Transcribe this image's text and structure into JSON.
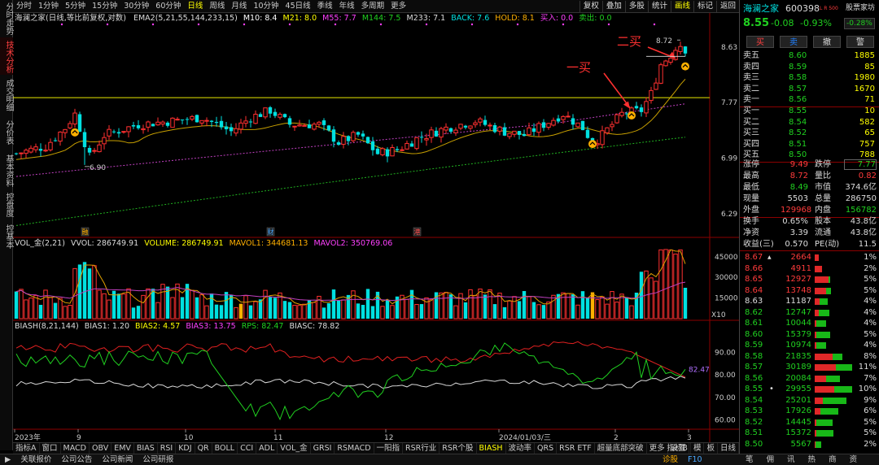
{
  "left_tabs": [
    "分时走势",
    "技术分析",
    "成交明细",
    "分价表",
    "基本资料",
    "控盘度",
    "控基本"
  ],
  "left_active": 1,
  "timeframes": [
    "分时",
    "1分钟",
    "5分钟",
    "15分钟",
    "30分钟",
    "60分钟",
    "日线",
    "周线",
    "月线",
    "10分钟",
    "45日线",
    "季线",
    "年线",
    "多周期",
    "更多"
  ],
  "timeframe_active": "日线",
  "toolbar": [
    "复权",
    "叠加",
    "多股",
    "统计",
    "画线",
    "标记",
    "返回"
  ],
  "toolbar_active": "画线",
  "chart_title": "海澜之家(日线,等比前复权,对数)",
  "ema_line": {
    "label": "EMA2(5,21,55,144,233,15)",
    "m10": "M10: 8.4",
    "m21": "M21: 8.0",
    "m55": "M55: 7.7",
    "m144": "M144: 7.5",
    "m233": "M233: 7.1",
    "back": "BACK: 7.6",
    "hold": "HOLD: 8.1",
    "buy": "买入: 0.0",
    "sell": "卖出: 0.0"
  },
  "price_axis": [
    "8.63",
    "7.77",
    "6.99",
    "6.29"
  ],
  "annotations": {
    "first_buy": "一买",
    "second_buy": "二买",
    "high_label": "8.72",
    "low_label": "6.90"
  },
  "event_marks": [
    "融",
    "财",
    "港"
  ],
  "vol_line": {
    "label": "VOL_金(2,21)",
    "vvol": "VVOL: 286749.91",
    "volume": "VOLUME: 286749.91",
    "mavol1": "MAVOL1: 344681.13",
    "mavol2": "MAVOL2: 350769.06"
  },
  "vol_axis": [
    "45000",
    "30000",
    "15000"
  ],
  "vol_unit": "X10",
  "bias_line": {
    "label": "BIASH(8,21,144)",
    "bias1": "BIAS1: 1.20",
    "bias2": "BIAS2: 4.57",
    "bias3": "BIAS3: 13.75",
    "rps": "RPS: 82.47",
    "biasc": "BIASC: 78.82"
  },
  "bias_axis": [
    "90.00",
    "80.00",
    "70.00",
    "60.00"
  ],
  "rps_value": "82.47",
  "date_axis": [
    "2023年",
    "9",
    "10",
    "11",
    "12",
    "2024/01/03/三",
    "2",
    "3"
  ],
  "bottom_tabs": [
    "指标A",
    "窗口",
    "MACD",
    "OBV",
    "EMV",
    "BIAS",
    "RSI",
    "KDJ",
    "QR",
    "BOLL",
    "CCI",
    "ADL",
    "VOL_金",
    "GRSI",
    "RSMACD",
    "一阳指",
    "RSR行业",
    "RSR个股",
    "BIASH",
    "波动率",
    "QRS",
    "RSR ETF",
    "超量底部突破",
    "更多",
    "设置"
  ],
  "bottom_active": "BIASH",
  "bottom_right": [
    "指标B",
    "模",
    "板",
    "日线"
  ],
  "status_items": [
    "关联报价",
    "公司公告",
    "公司新闻",
    "公司研报"
  ],
  "status_right": [
    "诊股",
    "F10"
  ],
  "quote": {
    "name": "海澜之家",
    "code": "600398",
    "tag": "L R 500",
    "fav": "股票家坊",
    "price": "8.55",
    "change": "-0.08",
    "pct": "-0.93%",
    "pct_box": "-0.28%",
    "buttons": [
      "买",
      "卖",
      "撤",
      "警"
    ],
    "asks": [
      {
        "label": "卖五",
        "price": "8.60",
        "vol": "1885"
      },
      {
        "label": "卖四",
        "price": "8.59",
        "vol": "85"
      },
      {
        "label": "卖三",
        "price": "8.58",
        "vol": "1980"
      },
      {
        "label": "卖二",
        "price": "8.57",
        "vol": "1670"
      },
      {
        "label": "卖一",
        "price": "8.56",
        "vol": "71"
      }
    ],
    "bids": [
      {
        "label": "买一",
        "price": "8.55",
        "vol": "10"
      },
      {
        "label": "买二",
        "price": "8.54",
        "vol": "582"
      },
      {
        "label": "买三",
        "price": "8.52",
        "vol": "65"
      },
      {
        "label": "买四",
        "price": "8.51",
        "vol": "757"
      },
      {
        "label": "买五",
        "price": "8.50",
        "vol": "788"
      }
    ],
    "stats": [
      {
        "l1": "涨停",
        "v1": "9.49",
        "l2": "跌停",
        "v2": "7.77"
      },
      {
        "l1": "最高",
        "v1": "8.72",
        "l2": "量比",
        "v2": "0.82"
      },
      {
        "l1": "最低",
        "v1": "8.49",
        "l2": "市值",
        "v2": "374.6亿"
      },
      {
        "l1": "现量",
        "v1": "5503",
        "l2": "总量",
        "v2": "286750"
      },
      {
        "l1": "外盘",
        "v1": "129968",
        "l2": "内盘",
        "v2": "156782"
      }
    ],
    "stats2": [
      {
        "l1": "换手",
        "v1": "0.65%",
        "l2": "股本",
        "v2": "43.8亿"
      },
      {
        "l1": "净资",
        "v1": "3.39",
        "l2": "流通",
        "v2": "43.8亿"
      },
      {
        "l1": "收益(三)",
        "v1": "0.570",
        "l2": "PE(动)",
        "v2": "11.5"
      }
    ],
    "distribution": [
      {
        "price": "8.67",
        "vol": "2664",
        "pct": "1%",
        "r": 0.1,
        "g": 0
      },
      {
        "price": "8.66",
        "vol": "4911",
        "pct": "2%",
        "r": 0.18,
        "g": 0
      },
      {
        "price": "8.65",
        "vol": "12927",
        "pct": "5%",
        "r": 0.35,
        "g": 0.05
      },
      {
        "price": "8.64",
        "vol": "13748",
        "pct": "5%",
        "r": 0.3,
        "g": 0.12
      },
      {
        "price": "8.63",
        "vol": "11187",
        "pct": "4%",
        "r": 0.12,
        "g": 0.22
      },
      {
        "price": "8.62",
        "vol": "12747",
        "pct": "4%",
        "r": 0.1,
        "g": 0.28
      },
      {
        "price": "8.61",
        "vol": "10044",
        "pct": "4%",
        "r": 0.05,
        "g": 0.25
      },
      {
        "price": "8.60",
        "vol": "15379",
        "pct": "5%",
        "r": 0.05,
        "g": 0.35
      },
      {
        "price": "8.59",
        "vol": "10974",
        "pct": "4%",
        "r": 0.05,
        "g": 0.25
      },
      {
        "price": "8.58",
        "vol": "21835",
        "pct": "8%",
        "r": 0.45,
        "g": 0.25
      },
      {
        "price": "8.57",
        "vol": "30189",
        "pct": "11%",
        "r": 0.55,
        "g": 0.4
      },
      {
        "price": "8.56",
        "vol": "20084",
        "pct": "7%",
        "r": 0.3,
        "g": 0.35
      },
      {
        "price": "8.55",
        "vol": "29955",
        "pct": "10%",
        "r": 0.5,
        "g": 0.45
      },
      {
        "price": "8.54",
        "vol": "25201",
        "pct": "9%",
        "r": 0.2,
        "g": 0.62
      },
      {
        "price": "8.53",
        "vol": "17926",
        "pct": "6%",
        "r": 0.15,
        "g": 0.45
      },
      {
        "price": "8.52",
        "vol": "14445",
        "pct": "5%",
        "r": 0.05,
        "g": 0.4
      },
      {
        "price": "8.51",
        "vol": "15372",
        "pct": "5%",
        "r": 0.05,
        "g": 0.42
      },
      {
        "price": "8.50",
        "vol": "5567",
        "pct": "2%",
        "r": 0.02,
        "g": 0.15
      }
    ],
    "footer_icons": [
      "笔",
      "佣",
      "讯",
      "热",
      "商",
      "资"
    ]
  }
}
